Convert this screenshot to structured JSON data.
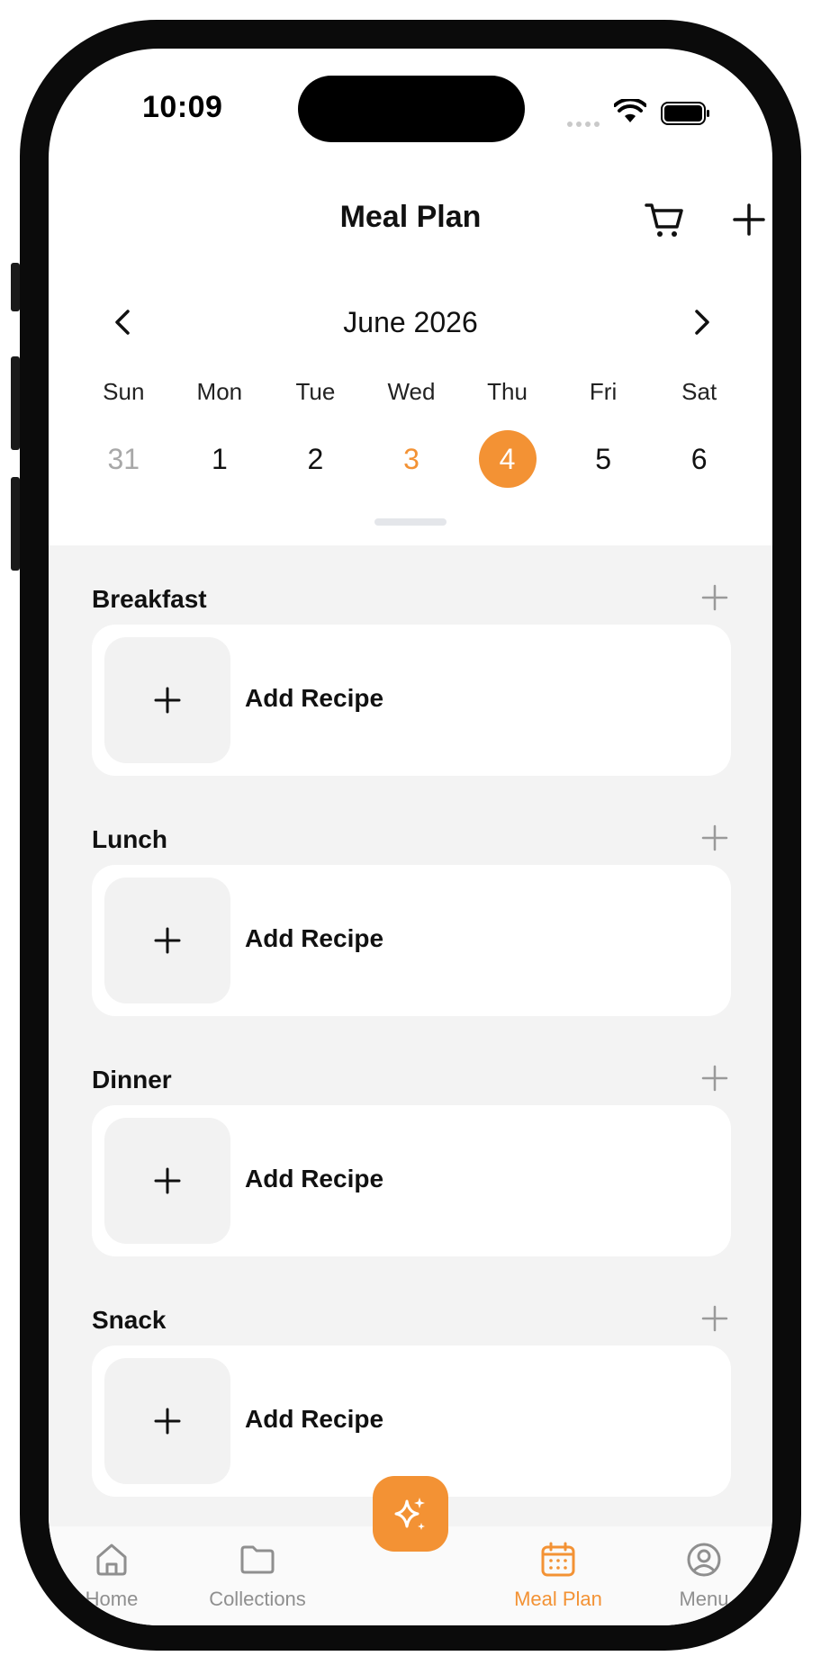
{
  "status": {
    "time": "10:09"
  },
  "header": {
    "title": "Meal Plan",
    "icons": {
      "cart": "shopping-cart-icon",
      "add": "plus-icon"
    }
  },
  "calendar": {
    "month_label": "June 2026",
    "weekdays": [
      "Sun",
      "Mon",
      "Tue",
      "Wed",
      "Thu",
      "Fri",
      "Sat"
    ],
    "dates": [
      "31",
      "1",
      "2",
      "3",
      "4",
      "5",
      "6"
    ],
    "today_index": 3,
    "selected_index": 4,
    "muted_index": 0
  },
  "meals": [
    {
      "title": "Breakfast",
      "card_label": "Add Recipe"
    },
    {
      "title": "Lunch",
      "card_label": "Add Recipe"
    },
    {
      "title": "Dinner",
      "card_label": "Add Recipe"
    },
    {
      "title": "Snack",
      "card_label": "Add Recipe"
    }
  ],
  "tabs": [
    {
      "label": "Home",
      "icon": "home-icon",
      "active": false
    },
    {
      "label": "Collections",
      "icon": "folder-icon",
      "active": false
    },
    {
      "label": "",
      "icon": "sparkle-icon",
      "active": false
    },
    {
      "label": "Meal Plan",
      "icon": "calendar-icon",
      "active": true
    },
    {
      "label": "Menu",
      "icon": "profile-icon",
      "active": false
    }
  ],
  "colors": {
    "accent": "#f39234",
    "content_bg": "#f3f3f3",
    "muted_text": "#a8a8a8",
    "inactive_tab": "#8f8f8f"
  }
}
